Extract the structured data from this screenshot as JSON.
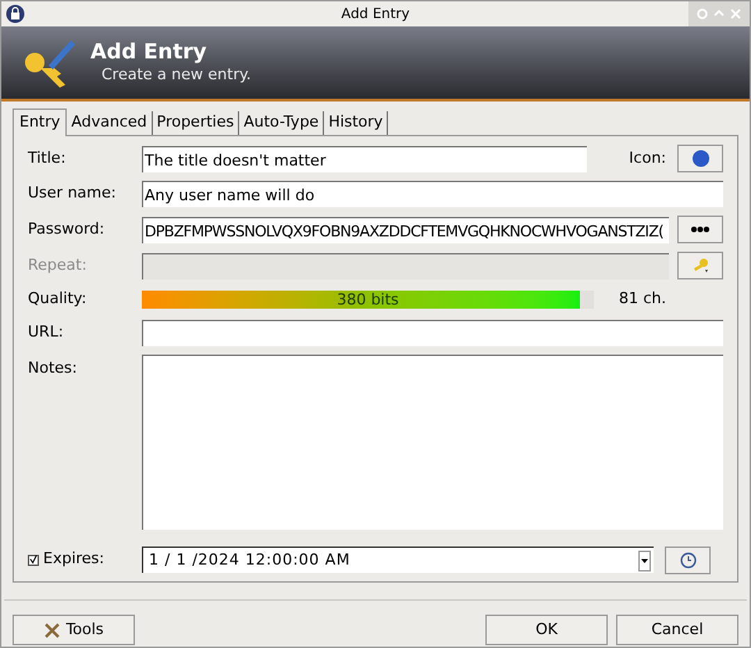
{
  "window": {
    "title": "Add Entry"
  },
  "header": {
    "title": "Add Entry",
    "subtitle": "Create a new entry."
  },
  "tabs": [
    {
      "label": "Entry",
      "selected": true
    },
    {
      "label": "Advanced",
      "selected": false
    },
    {
      "label": "Properties",
      "selected": false
    },
    {
      "label": "Auto-Type",
      "selected": false
    },
    {
      "label": "History",
      "selected": false
    }
  ],
  "fields": [
    {
      "kind": "text",
      "label": "Title:",
      "value": "The title doesn't matter",
      "side_label": "Icon:",
      "disabled": false
    },
    {
      "kind": "text",
      "label": "User name:",
      "value": "Any user name will do",
      "disabled": false
    },
    {
      "kind": "text",
      "label": "Password:",
      "value": "DPBZFMPWSSNOLVQX9FOBN9AXZDDCFTEMVGQHKNOCWHVOGANSTZIZ(",
      "disabled": false
    },
    {
      "kind": "text",
      "label": "Repeat:",
      "disabled": true
    },
    {
      "kind": "quality",
      "label": "Quality:",
      "reading": "380 bits",
      "level": 0.97,
      "count": "81 ch."
    },
    {
      "kind": "text",
      "label": "URL:",
      "disabled": false
    },
    {
      "kind": "notes",
      "label": "Notes:"
    },
    {
      "kind": "expires",
      "label": "Expires:",
      "checked": true,
      "value": "1 / 1 /2024 12:00:00 AM"
    }
  ],
  "buttons": {
    "tools": "Tools",
    "ok": "OK",
    "cancel": "Cancel"
  }
}
